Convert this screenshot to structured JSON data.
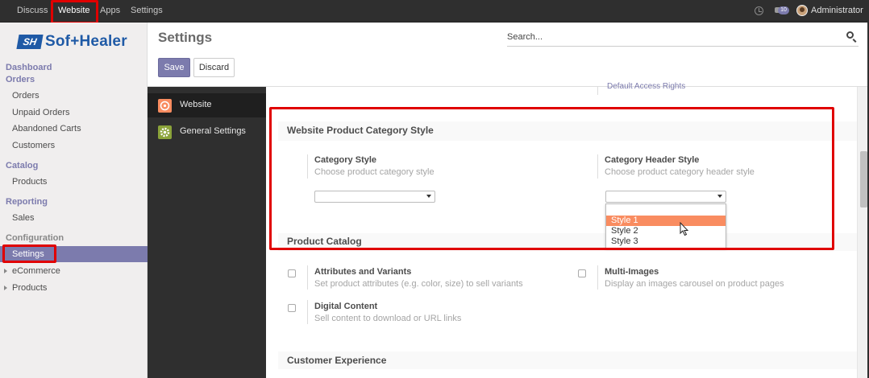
{
  "topbar": {
    "menus": [
      "Discuss",
      "Website",
      "Apps",
      "Settings"
    ],
    "active_menu": "Website",
    "chat_badge": "10",
    "user": "Administrator"
  },
  "brand": {
    "logo_mark": "SH",
    "logo_text": "Sof+Healer"
  },
  "sidebar": {
    "dashboard": "Dashboard",
    "orders_head": "Orders",
    "orders_items": [
      "Orders",
      "Unpaid Orders",
      "Abandoned Carts",
      "Customers"
    ],
    "catalog_head": "Catalog",
    "catalog_items": [
      "Products"
    ],
    "reporting_head": "Reporting",
    "reporting_items": [
      "Sales"
    ],
    "config_head": "Configuration",
    "config_items": [
      "Settings",
      "eCommerce",
      "Products"
    ],
    "active_item": "Settings"
  },
  "control_panel": {
    "title": "Settings",
    "search_placeholder": "Search...",
    "save_label": "Save",
    "discard_label": "Discard"
  },
  "apps": [
    {
      "label": "Website",
      "icon": "website-icon",
      "color": "#f98c60"
    },
    {
      "label": "General Settings",
      "icon": "gear-icon",
      "color": "#8ba33a"
    }
  ],
  "form": {
    "partial_link": "Default Access Rights",
    "category_section": {
      "title": "Website Product Category Style",
      "category_style_label": "Category Style",
      "category_style_help": "Choose product category style",
      "category_style_value": "",
      "header_style_label": "Category Header Style",
      "header_style_help": "Choose product category header style",
      "header_style_value": "",
      "header_style_options": [
        "",
        "Style 1",
        "Style 2",
        "Style 3"
      ],
      "highlighted_option": "Style 1"
    },
    "catalog_section": {
      "title": "Product Catalog",
      "attributes_label": "Attributes and Variants",
      "attributes_help": "Set product attributes (e.g. color, size) to sell variants",
      "multi_images_label": "Multi-Images",
      "multi_images_help": "Display an images carousel on product pages",
      "digital_label": "Digital Content",
      "digital_help": "Sell content to download or URL links"
    },
    "customer_section": {
      "title": "Customer Experience"
    }
  },
  "colors": {
    "accent": "#7c7bad",
    "highlight_box": "#e00000",
    "dropdown_highlight": "#f98c60",
    "navbar": "#2f2f2f"
  }
}
